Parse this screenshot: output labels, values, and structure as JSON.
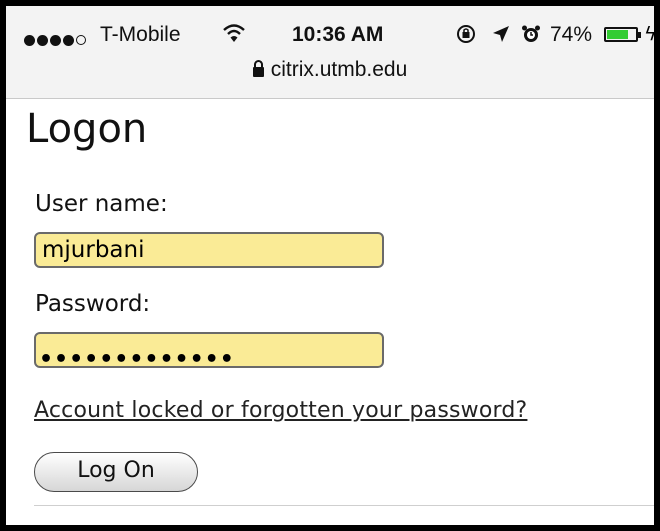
{
  "status_bar": {
    "carrier": "T-Mobile",
    "time": "10:36 AM",
    "battery_percent": "74%",
    "battery_level": 0.74,
    "signal_bars_filled": 4,
    "signal_bars_total": 5,
    "icons": [
      "signal-dots-icon",
      "wifi-icon",
      "rotation-lock-icon",
      "location-arrow-icon",
      "alarm-icon",
      "battery-icon",
      "charging-bolt-icon"
    ]
  },
  "browser": {
    "url": "citrix.utmb.edu",
    "secure_icon": "lock-icon"
  },
  "page": {
    "title": "Logon",
    "username_label": "User name:",
    "username_value": "mjurbani",
    "password_label": "Password:",
    "password_masked": "•••••••••••••",
    "forgot_link": "Account locked or forgotten your password?",
    "logon_button": "Log On"
  },
  "colors": {
    "field_autofill": "#faeb96",
    "battery_fill": "#33cc33",
    "statusbar_bg": "#f3f3f3"
  }
}
